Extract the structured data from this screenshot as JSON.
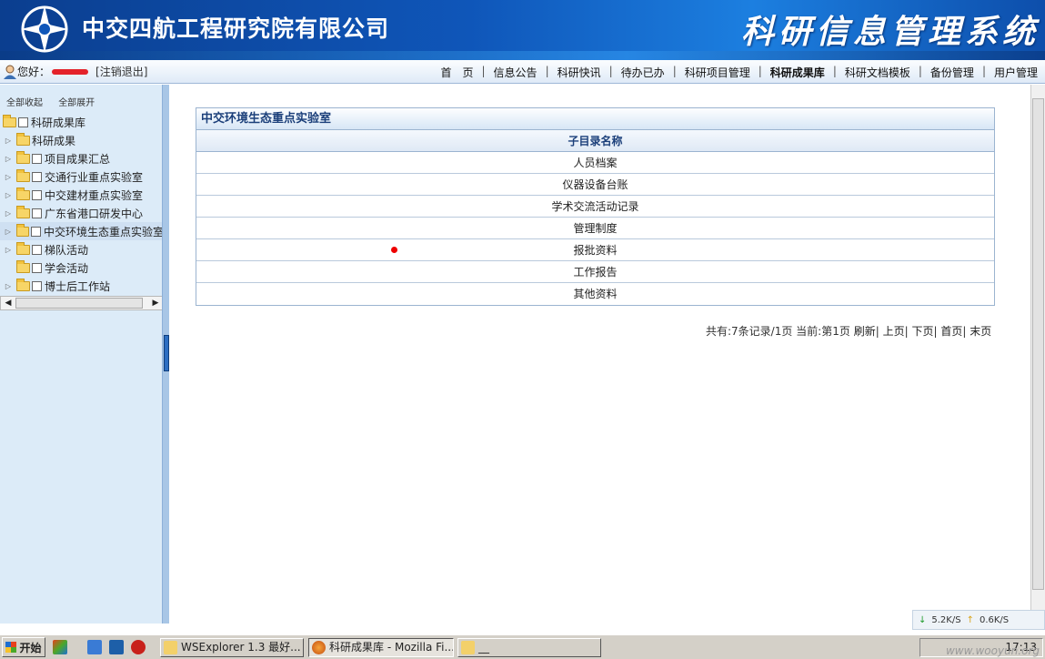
{
  "header": {
    "company": "中交四航工程研究院有限公司",
    "system_name": "科研信息管理系统"
  },
  "navbar": {
    "greeting": "您好：",
    "logout": "[注销退出]",
    "menu": [
      {
        "label": "首　页",
        "active": false
      },
      {
        "label": "信息公告",
        "active": false
      },
      {
        "label": "科研快讯",
        "active": false
      },
      {
        "label": "待办已办",
        "active": false
      },
      {
        "label": "科研项目管理",
        "active": false
      },
      {
        "label": "科研成果库",
        "active": true
      },
      {
        "label": "科研文档模板",
        "active": false
      },
      {
        "label": "备份管理",
        "active": false
      },
      {
        "label": "用户管理",
        "active": false
      }
    ],
    "separator": "|"
  },
  "sidebar": {
    "collapse_all": "全部收起",
    "expand_all": "全部展开",
    "root": "科研成果库",
    "items": [
      {
        "label": "科研成果",
        "checkbox": false
      },
      {
        "label": "项目成果汇总",
        "checkbox": true
      },
      {
        "label": "交通行业重点实验室",
        "checkbox": true
      },
      {
        "label": "中交建材重点实验室",
        "checkbox": true
      },
      {
        "label": "广东省港口研发中心",
        "checkbox": true
      },
      {
        "label": "中交环境生态重点实验室",
        "checkbox": true,
        "selected": true
      },
      {
        "label": "梯队活动",
        "checkbox": true
      },
      {
        "label": "学会活动",
        "checkbox": true
      },
      {
        "label": "博士后工作站",
        "checkbox": true
      }
    ]
  },
  "main": {
    "grid_title": "中交环境生态重点实验室",
    "column_header": "子目录名称",
    "rows": [
      "人员档案",
      "仪器设备台账",
      "学术交流活动记录",
      "管理制度",
      "报批资料",
      "工作报告",
      "其他资料"
    ],
    "pager": {
      "summary": "共有:7条记录/1页 当前:第1页",
      "refresh": "刷新",
      "prev": "上页",
      "next": "下页",
      "first": "首页",
      "last": "末页",
      "separator": "|"
    }
  },
  "netspeed": {
    "down": "5.2K/S",
    "up": "0.6K/S"
  },
  "taskbar": {
    "start": "开始",
    "tasks": [
      {
        "label": "WSExplorer 1.3 最好...",
        "active": false
      },
      {
        "label": "科研成果库 - Mozilla Fi...",
        "active": true
      },
      {
        "label": "__",
        "active": false
      }
    ],
    "clock": "17:13",
    "watermark": "www.wooyun.org"
  },
  "colors": {
    "banner": "#0f56b9",
    "grid_title_text": "#1b3f7a",
    "marker": "#ee0000"
  }
}
